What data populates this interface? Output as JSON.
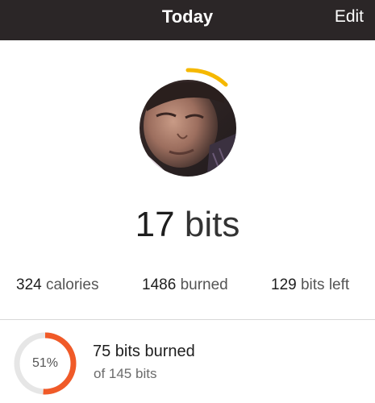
{
  "header": {
    "title": "Today",
    "edit_label": "Edit"
  },
  "profile": {
    "avatar_icon": "user-photo",
    "goal_arc_color": "#f5b800"
  },
  "summary": {
    "bits_value": "17",
    "bits_unit": "bits"
  },
  "stats": {
    "calories_value": "324",
    "calories_label": "calories",
    "burned_value": "1486",
    "burned_label": "burned",
    "left_value": "129",
    "left_label": "bits left"
  },
  "progress": {
    "percent_label": "51%",
    "percent_value": 0.51,
    "title": "75 bits burned",
    "subtitle": "of 145 bits",
    "ring_color": "#f05a28",
    "track_color": "#e6e6e6"
  }
}
